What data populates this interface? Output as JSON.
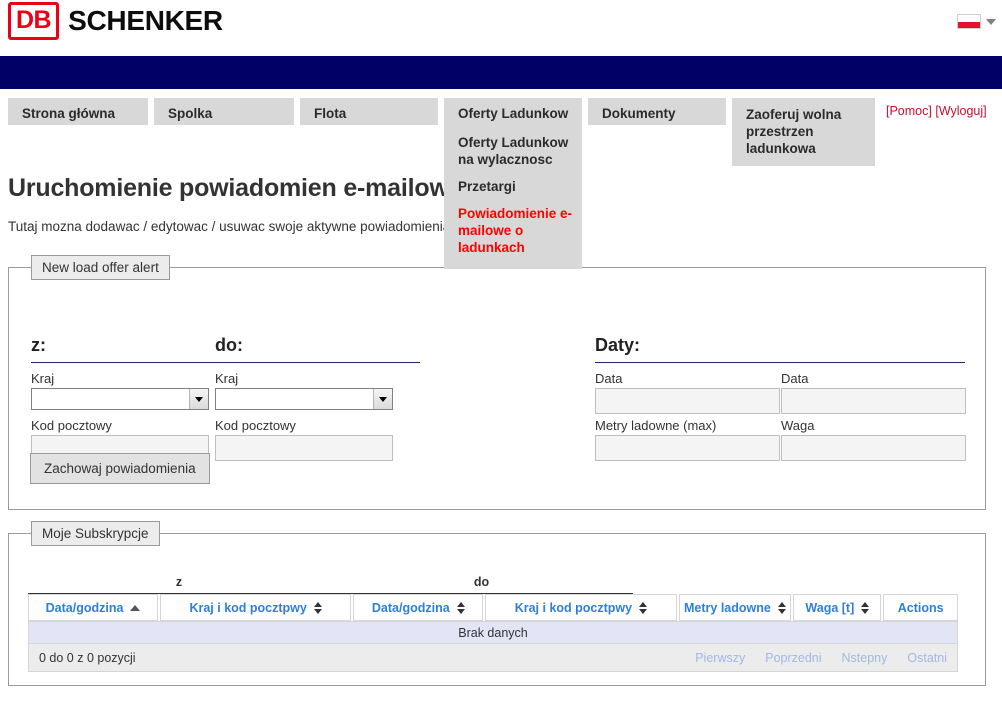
{
  "brand": {
    "mark": "DB",
    "name": "SCHENKER",
    "accent_red": "#EC0016",
    "navy": "#000066"
  },
  "language": {
    "flag_name": "poland-flag",
    "caret": "chevron-down-icon"
  },
  "nav": {
    "tabs": [
      {
        "label": "Strona główna"
      },
      {
        "label": "Spolka"
      },
      {
        "label": "Flota"
      },
      {
        "label": "Oferty Ladunkow"
      },
      {
        "label": "Dokumenty"
      },
      {
        "label": "Zaoferuj wolna przestrzen ladunkowa"
      }
    ],
    "dropdown": {
      "head": "Oferty Ladunkow",
      "items": [
        {
          "label": "Oferty Ladunkow na wylacznosc",
          "active": false
        },
        {
          "label": "Przetargi",
          "active": false
        },
        {
          "label": "Powiadomienie e-mailowe o ladunkach",
          "active": true
        }
      ]
    },
    "help_link": "[Pomoc]",
    "logout_link": "[Wyloguj]"
  },
  "page": {
    "title": "Uruchomienie powiadomien e-mailowych",
    "description": "Tutaj mozna dodawac / edytowac / usuwac swoje aktywne powiadomienia elektroniczne"
  },
  "alert_form": {
    "legend": "New load offer alert",
    "from": {
      "heading": "z:",
      "country_label": "Kraj",
      "country_value": "",
      "postcode_label": "Kod pocztowy",
      "postcode_value": ""
    },
    "to": {
      "heading": "do:",
      "country_label": "Kraj",
      "country_value": "",
      "postcode_label": "Kod pocztowy",
      "postcode_value": ""
    },
    "dates": {
      "heading": "Daty:",
      "date_from_label": "Data",
      "date_from_value": "",
      "date_to_label": "Data",
      "date_to_value": "",
      "loading_meters_label": "Metry ladowne (max)",
      "loading_meters_value": "",
      "weight_label": "Waga",
      "weight_value": ""
    },
    "save_button": "Zachowaj powiadomienia"
  },
  "subscriptions": {
    "legend": "Moje Subskrypcje",
    "group_headers": {
      "from": "z",
      "to": "do"
    },
    "columns": [
      {
        "label": "Data/godzina",
        "sort": "asc"
      },
      {
        "label": "Kraj i kod pocztpwy",
        "sort": "both"
      },
      {
        "label": "Data/godzina",
        "sort": "both"
      },
      {
        "label": "Kraj i kod pocztpwy",
        "sort": "both"
      },
      {
        "label": "Metry ladowne",
        "sort": "both"
      },
      {
        "label": "Waga [t]",
        "sort": "both"
      },
      {
        "label": "Actions",
        "sort": "none"
      }
    ],
    "rows": [],
    "empty_message": "Brak danych",
    "count_text": "0 do 0 z 0 pozycji",
    "pager": [
      "Pierwszy",
      "Poprzedni",
      "Nstepny",
      "Ostatni"
    ]
  }
}
